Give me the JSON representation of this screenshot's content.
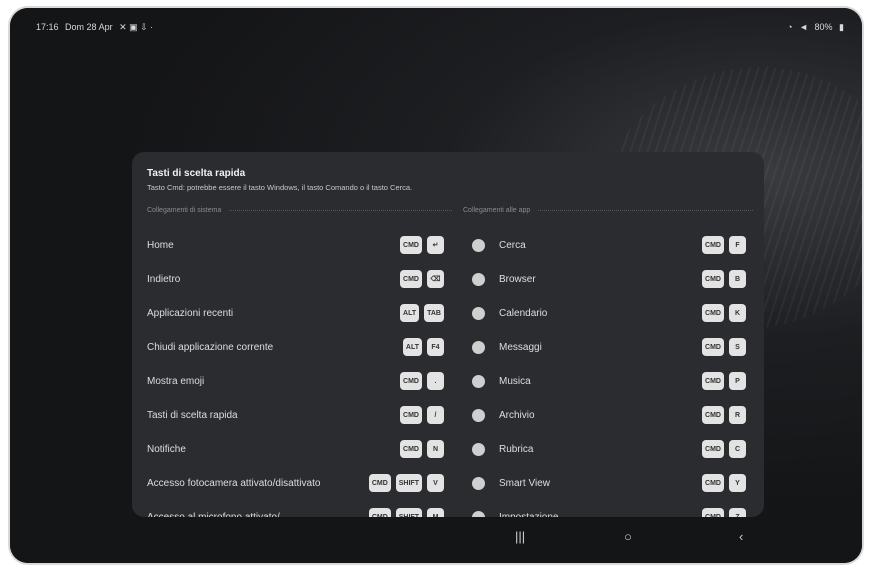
{
  "status": {
    "time": "17:16",
    "date": "Dom 28 Apr",
    "battery": "80%"
  },
  "panel": {
    "title": "Tasti di scelta rapida",
    "subtitle": "Tasto Cmd: potrebbe essere il tasto Windows, il tasto Comando o il tasto Cerca."
  },
  "sections": {
    "system": "Collegamenti di sistema",
    "apps": "Collegamenti alle app"
  },
  "system_items": [
    {
      "label": "Home",
      "keys": [
        "CMD",
        "↵"
      ]
    },
    {
      "label": "Indietro",
      "keys": [
        "CMD",
        "⌫"
      ]
    },
    {
      "label": "Applicazioni recenti",
      "keys": [
        "ALT",
        "TAB"
      ]
    },
    {
      "label": "Chiudi applicazione corrente",
      "keys": [
        "ALT",
        "F4"
      ]
    },
    {
      "label": "Mostra emoji",
      "keys": [
        "CMD",
        "."
      ]
    },
    {
      "label": "Tasti di scelta rapida",
      "keys": [
        "CMD",
        "/"
      ]
    },
    {
      "label": "Notifiche",
      "keys": [
        "CMD",
        "N"
      ]
    },
    {
      "label": "Accesso fotocamera attivato/disattivato",
      "keys": [
        "CMD",
        "SHIFT",
        "V"
      ]
    },
    {
      "label": "Accesso al microfono attivato/",
      "keys": [
        "CMD",
        "SHIFT",
        "M"
      ]
    }
  ],
  "app_items": [
    {
      "label": "Cerca",
      "icon": "search-icon",
      "keys": [
        "CMD",
        "F"
      ]
    },
    {
      "label": "Browser",
      "icon": "browser-icon",
      "keys": [
        "CMD",
        "B"
      ]
    },
    {
      "label": "Calendario",
      "icon": "calendar-icon",
      "keys": [
        "CMD",
        "K"
      ]
    },
    {
      "label": "Messaggi",
      "icon": "messages-icon",
      "keys": [
        "CMD",
        "S"
      ]
    },
    {
      "label": "Musica",
      "icon": "music-icon",
      "keys": [
        "CMD",
        "P"
      ]
    },
    {
      "label": "Archivio",
      "icon": "folder-icon",
      "keys": [
        "CMD",
        "R"
      ]
    },
    {
      "label": "Rubrica",
      "icon": "contacts-icon",
      "keys": [
        "CMD",
        "C"
      ]
    },
    {
      "label": "Smart View",
      "icon": "smart-view-icon",
      "keys": [
        "CMD",
        "Y"
      ]
    },
    {
      "label": "Impostazione",
      "icon": "settings-icon",
      "keys": [
        "CMD",
        "Z"
      ]
    }
  ],
  "nav": {
    "recents": "|||",
    "home": "○",
    "back": "‹"
  }
}
